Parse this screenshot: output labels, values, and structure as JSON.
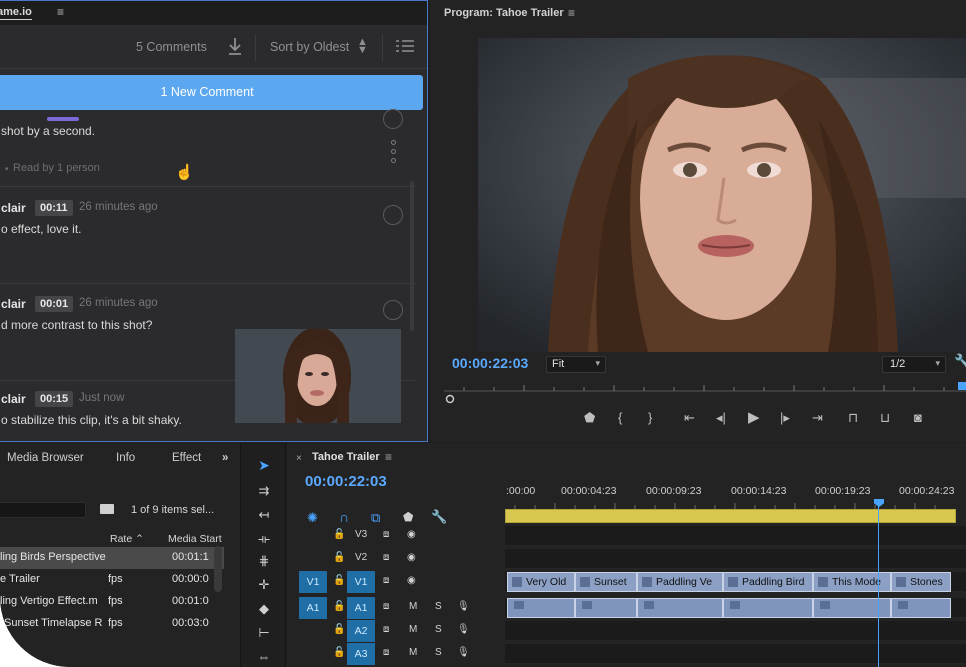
{
  "frame_panel": {
    "tab_title": "ame.io",
    "menu_icon": "hamburger-icon",
    "comments_count": "5 Comments",
    "sort_label": "Sort by Oldest",
    "new_comment_banner": "1 New Comment",
    "comments": [
      {
        "author": "",
        "timecode": "",
        "time": "",
        "text": "shot by a second.",
        "read_by": "Read by 1 person"
      },
      {
        "author": "clair",
        "timecode": "00:11",
        "time": "26 minutes ago",
        "text": "o effect, love it."
      },
      {
        "author": "clair",
        "timecode": "00:01",
        "time": "26 minutes ago",
        "text": "d more contrast to this shot?"
      },
      {
        "author": "clair",
        "timecode": "00:15",
        "time": "Just now",
        "text": "o stabilize this clip, it's a bit shaky."
      }
    ]
  },
  "program": {
    "title": "Program: Tahoe Trailer",
    "menu_icon": "hamburger-icon",
    "timecode": "00:00:22:03",
    "zoom": "Fit",
    "resolution": "1/2"
  },
  "project_panel": {
    "tabs": [
      "Media Browser",
      "Info",
      "Effect"
    ],
    "more": "»",
    "item_count": "1 of 9 items sel...",
    "columns": [
      "Rate",
      "Media Start"
    ],
    "rows": [
      {
        "name": "ling Birds Perspective.",
        "rate": "fps",
        "start": "00:01:1"
      },
      {
        "name": "e Trailer",
        "rate": "fps",
        "start": "00:00:0"
      },
      {
        "name": "ling Vertigo Effect.m",
        "rate": "fps",
        "start": "00:01:0"
      },
      {
        "name": "Sunset Timelapse R",
        "rate": "fps",
        "start": "00:03:0"
      }
    ]
  },
  "timeline": {
    "close": "×",
    "title": "Tahoe Trailer",
    "menu_icon": "hamburger-icon",
    "timecode": "00:00:22:03",
    "ruler": [
      ":00:00",
      "00:00:04:23",
      "00:00:09:23",
      "00:00:14:23",
      "00:00:19:23",
      "00:00:24:23"
    ],
    "tracks": [
      {
        "src": "",
        "name": "V3",
        "kind": "video"
      },
      {
        "src": "",
        "name": "V2",
        "kind": "video"
      },
      {
        "src": "V1",
        "name": "V1",
        "kind": "video"
      },
      {
        "src": "A1",
        "name": "A1",
        "kind": "audio"
      },
      {
        "src": "",
        "name": "A2",
        "kind": "audio"
      },
      {
        "src": "",
        "name": "A3",
        "kind": "audio"
      }
    ],
    "video_clips": [
      "Very Old",
      "Sunset",
      "Paddling Ve",
      "Paddling Bird",
      "This Mode",
      "Stones"
    ],
    "track_labels": {
      "m": "M",
      "s": "S"
    }
  },
  "colors": {
    "accent_blue": "#5aa9ff",
    "banner_blue": "#5ba7f0",
    "selection_border": "#4a79c9"
  }
}
